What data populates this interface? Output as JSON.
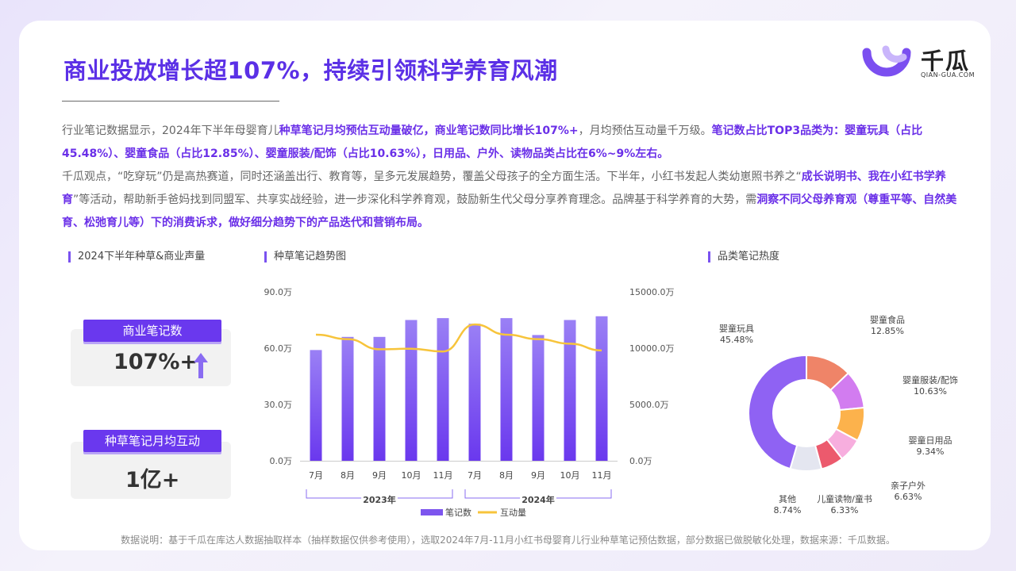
{
  "header": {
    "title": "商业投放增长超107%，持续引领科学养育风潮",
    "logo_text": "千瓜",
    "logo_sub": "QIAN-GUA.COM"
  },
  "paragraph1": [
    {
      "t": "行业笔记数据显示，2024年下半年母婴育儿",
      "b": false
    },
    {
      "t": "种草笔记月均预估互动量破亿，商业笔记数同比增长107%+",
      "b": true
    },
    {
      "t": "，月均预估互动量千万级。",
      "b": false
    },
    {
      "t": "笔记数占比TOP3品类为：婴童玩具（占比45.48%）、婴童食品（占比12.85%）、婴童服装/配饰（占比10.63%），日用品、户外、读物品类占比在6%~9%左右。",
      "b": true
    }
  ],
  "paragraph2": [
    {
      "t": "千瓜观点，“吃穿玩”仍是高热赛道，同时还涵盖出行、教育等，呈多元发展趋势，覆盖父母孩子的全方面生活。下半年，小红书发起人类幼崽照书养之“",
      "b": false
    },
    {
      "t": "成长说明书、我在小红书学养育",
      "b": true
    },
    {
      "t": "”等活动，帮助新手爸妈找到同盟军、共享实战经验，进一步深化科学养育观，鼓励新生代父母分享养育理念。品牌基于科学养育的大势，需",
      "b": false
    },
    {
      "t": "洞察不同父母养育观（尊重平等、自然美育、松弛育儿等）下的消费诉求，做好细分趋势下的产品迭代和营销布局。",
      "b": true
    }
  ],
  "left_panel": {
    "section_title": "2024下半年种草&商业声量",
    "stat1_label": "商业笔记数",
    "stat1_value": "107%+",
    "stat2_label": "种草笔记月均互动",
    "stat2_value": "1亿+"
  },
  "trend_section_title": "种草笔记趋势图",
  "category_section_title": "品类笔记热度",
  "colors": {
    "accent": "#6a38ee",
    "bar": "#7d55ee",
    "line": "#f7c43b"
  },
  "chart_data": [
    {
      "type": "bar",
      "categories": [
        "7月",
        "8月",
        "9月",
        "10月",
        "11月",
        "7月",
        "8月",
        "9月",
        "10月",
        "11月"
      ],
      "groups": [
        {
          "label": "2023年",
          "from": 0,
          "to": 4
        },
        {
          "label": "2024年",
          "from": 5,
          "to": 9
        }
      ],
      "series": [
        {
          "name": "笔记数",
          "type": "bar",
          "axis": "left",
          "values": [
            59,
            66,
            66,
            75,
            76,
            73,
            76,
            67,
            75,
            77
          ]
        },
        {
          "name": "互动量",
          "type": "line",
          "axis": "right",
          "values": [
            11200,
            10800,
            9900,
            9950,
            9700,
            12100,
            11200,
            10800,
            10400,
            9800
          ]
        }
      ],
      "y_left": {
        "ticks": [
          "0.0万",
          "30.0万",
          "60.0万",
          "90.0万"
        ],
        "ylim": [
          0,
          90
        ]
      },
      "y_right": {
        "ticks": [
          "0.0万",
          "5000.0万",
          "10000.0万",
          "15000.0万"
        ],
        "ylim": [
          0,
          15000
        ]
      },
      "legend_position": "bottom"
    },
    {
      "type": "pie",
      "donut": true,
      "slices": [
        {
          "label": "婴童玩具",
          "value": 45.48,
          "pct": "45.48%",
          "color": "#8f62f3"
        },
        {
          "label": "婴童食品",
          "value": 12.85,
          "pct": "12.85%",
          "color": "#ef8468"
        },
        {
          "label": "婴童服装/配饰",
          "value": 10.63,
          "pct": "10.63%",
          "color": "#d27cf0"
        },
        {
          "label": "婴童日用品",
          "value": 9.34,
          "pct": "9.34%",
          "color": "#fcb24c"
        },
        {
          "label": "亲子户外",
          "value": 6.63,
          "pct": "6.63%",
          "color": "#f7aede"
        },
        {
          "label": "儿童读物/童书",
          "value": 6.33,
          "pct": "6.33%",
          "color": "#ec5a6d"
        },
        {
          "label": "其他",
          "value": 8.74,
          "pct": "8.74%",
          "color": "#e4e6f0"
        }
      ]
    }
  ],
  "footer": "数据说明：基于千瓜在库达人数据抽取样本（抽样数据仅供参考使用），选取2024年7月-11月小红书母婴育儿行业种草笔记预估数据，部分数据已做脱敏化处理，数据来源：千瓜数据。"
}
